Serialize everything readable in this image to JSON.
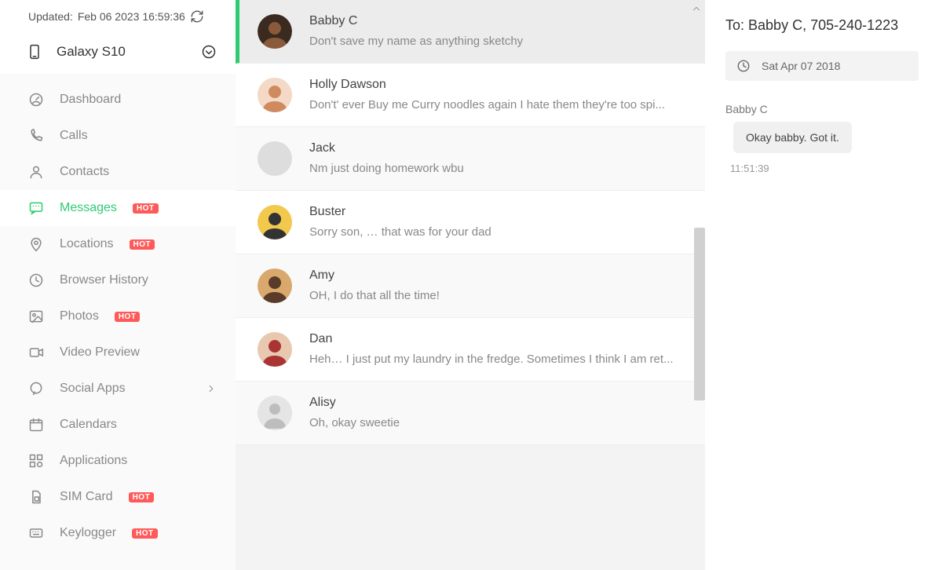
{
  "header": {
    "updated_prefix": "Updated:",
    "updated_time": "Feb 06 2023 16:59:36"
  },
  "device": {
    "name": "Galaxy S10"
  },
  "sidebar": {
    "items": [
      {
        "id": "dashboard",
        "label": "Dashboard",
        "icon": "gauge-icon",
        "hot": false
      },
      {
        "id": "calls",
        "label": "Calls",
        "icon": "phone-icon",
        "hot": false
      },
      {
        "id": "contacts",
        "label": "Contacts",
        "icon": "person-icon",
        "hot": false
      },
      {
        "id": "messages",
        "label": "Messages",
        "icon": "chat-icon",
        "hot": true,
        "active": true
      },
      {
        "id": "locations",
        "label": "Locations",
        "icon": "pin-icon",
        "hot": true
      },
      {
        "id": "browser-history",
        "label": "Browser History",
        "icon": "clock-icon",
        "hot": false
      },
      {
        "id": "photos",
        "label": "Photos",
        "icon": "image-icon",
        "hot": true
      },
      {
        "id": "video-preview",
        "label": "Video Preview",
        "icon": "video-icon",
        "hot": false
      },
      {
        "id": "social-apps",
        "label": "Social Apps",
        "icon": "bubble-icon",
        "hot": false,
        "expandable": true
      },
      {
        "id": "calendars",
        "label": "Calendars",
        "icon": "calendar-icon",
        "hot": false
      },
      {
        "id": "applications",
        "label": "Applications",
        "icon": "apps-icon",
        "hot": false
      },
      {
        "id": "sim-card",
        "label": "SIM Card",
        "icon": "sim-icon",
        "hot": true
      },
      {
        "id": "keylogger",
        "label": "Keylogger",
        "icon": "keyboard-icon",
        "hot": true
      }
    ],
    "hot_label": "HOT"
  },
  "conversations": [
    {
      "name": "Babby C",
      "preview": "Don't save my name as anything sketchy",
      "avatar": "person1",
      "selected": true
    },
    {
      "name": "Holly Dawson",
      "preview": "Don't' ever Buy me Curry noodles again I hate them they're too spi...",
      "avatar": "person2"
    },
    {
      "name": "Jack",
      "preview": "Nm just doing homework wbu",
      "avatar": "blank"
    },
    {
      "name": "Buster",
      "preview": "Sorry son, … that was for your dad",
      "avatar": "person3"
    },
    {
      "name": "Amy",
      "preview": "OH, I do that all the time!",
      "avatar": "person4"
    },
    {
      "name": "Dan",
      "preview": "Heh… I just put my laundry in the fredge. Sometimes I think I am ret...",
      "avatar": "person5"
    },
    {
      "name": "Alisy",
      "preview": "Oh, okay sweetie",
      "avatar": "silhouette"
    }
  ],
  "detail": {
    "to_prefix": "To:",
    "to_name": "Babby C",
    "to_number": "705-240-1223",
    "date": "Sat Apr 07 2018",
    "messages": [
      {
        "sender": "Babby C",
        "text": "Okay babby. Got it.",
        "time": "11:51:39"
      }
    ]
  }
}
